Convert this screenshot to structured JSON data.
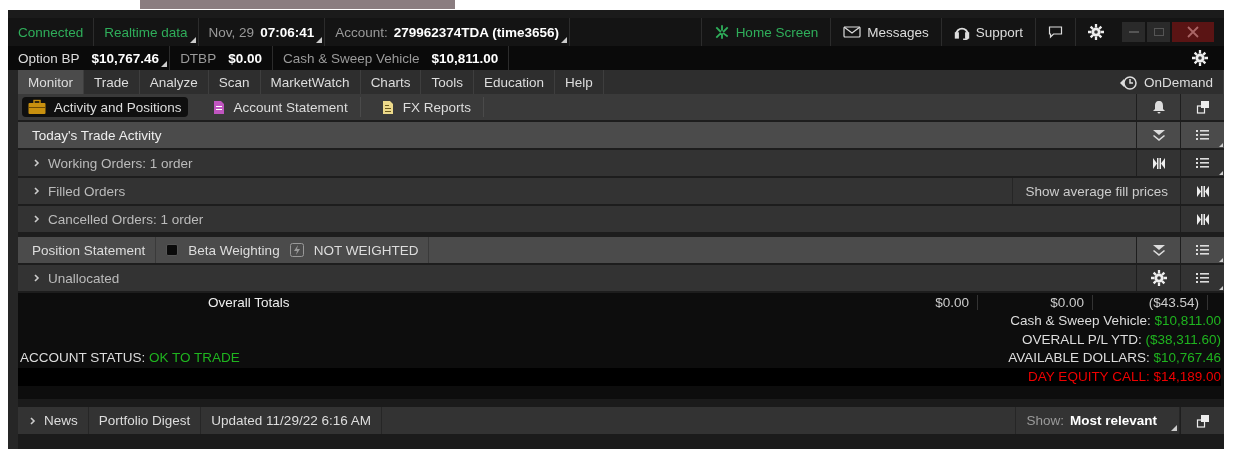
{
  "status_bar": {
    "connection": "Connected",
    "data_feed": "Realtime data",
    "date": "Nov, 29",
    "time": "07:06:41",
    "account_label": "Account:",
    "account": "279962374TDA (time3656)",
    "buttons": [
      {
        "kind": "home",
        "label": "Home Screen"
      },
      {
        "kind": "mail",
        "label": "Messages"
      },
      {
        "kind": "headset",
        "label": "Support"
      },
      {
        "kind": "chat"
      },
      {
        "kind": "gear"
      }
    ]
  },
  "balances": [
    {
      "label": "Option BP",
      "value": "$10,767.46",
      "dropdown": true
    },
    {
      "label": "DTBP",
      "value": "$0.00",
      "dropdown": false
    },
    {
      "label": "Cash & Sweep Vehicle",
      "value": "$10,811.00",
      "dropdown": false
    }
  ],
  "menu": [
    {
      "label": "Monitor",
      "selected": true
    },
    {
      "label": "Trade",
      "selected": false
    },
    {
      "label": "Analyze",
      "selected": false
    },
    {
      "label": "Scan",
      "selected": false
    },
    {
      "label": "MarketWatch",
      "selected": false
    },
    {
      "label": "Charts",
      "selected": false
    },
    {
      "label": "Tools",
      "selected": false
    },
    {
      "label": "Education",
      "selected": false
    },
    {
      "label": "Help",
      "selected": false
    }
  ],
  "on_demand": "OnDemand",
  "subtabs": [
    {
      "kind": "briefcase",
      "label": "Activity and Positions",
      "selected": true
    },
    {
      "kind": "statement",
      "label": "Account Statement",
      "selected": false
    },
    {
      "kind": "report",
      "label": "FX Reports",
      "selected": false
    }
  ],
  "sections": [
    {
      "kind": "header",
      "title": "Today's Trade Activity",
      "tools": [
        {
          "kind": "chevrons"
        },
        {
          "kind": "list"
        }
      ]
    },
    {
      "kind": "group",
      "title": "Working Orders: 1 order",
      "expanded": false,
      "tools": [
        {
          "kind": "collapse"
        },
        {
          "kind": "list"
        }
      ]
    },
    {
      "kind": "group",
      "title": "Filled Orders",
      "expanded": false,
      "action": "Show average fill prices",
      "tools": [
        {
          "kind": "collapse"
        }
      ]
    },
    {
      "kind": "group",
      "title": "Cancelled Orders: 1 order",
      "expanded": false,
      "tools": [
        {
          "kind": "collapse"
        }
      ]
    },
    {
      "kind": "position",
      "title": "Position Statement",
      "checkbox_label": "Beta Weighting",
      "checked": false,
      "weighting": "NOT WEIGHTED",
      "tools": [
        {
          "kind": "chevrons"
        },
        {
          "kind": "list"
        }
      ]
    },
    {
      "kind": "group",
      "title": "Unallocated",
      "expanded": false,
      "tools": [
        {
          "kind": "gear"
        },
        {
          "kind": "list"
        }
      ]
    }
  ],
  "totals": {
    "label": "Overall Totals",
    "columns": [
      "$0.00",
      "$0.00",
      "($43.54)"
    ]
  },
  "summary": [
    {
      "label": "Cash & Sweep Vehicle:",
      "value": "$10,811.00",
      "alert": false
    },
    {
      "label": "OVERALL P/L YTD:",
      "value": "($38,311.60)",
      "alert": false
    },
    {
      "label": "AVAILABLE DOLLARS:",
      "value": "$10,767.46",
      "alert": false
    },
    {
      "label": "DAY EQUITY CALL:",
      "value": "$14,189.00",
      "alert": true
    }
  ],
  "account_status": {
    "label": "ACCOUNT STATUS:",
    "value": "OK TO TRADE"
  },
  "news": {
    "title": "News",
    "expanded": false,
    "tab": "Portfolio Digest",
    "updated": "Updated 11/29/22 6:16 AM",
    "show_label": "Show:",
    "show_value": "Most relevant"
  }
}
